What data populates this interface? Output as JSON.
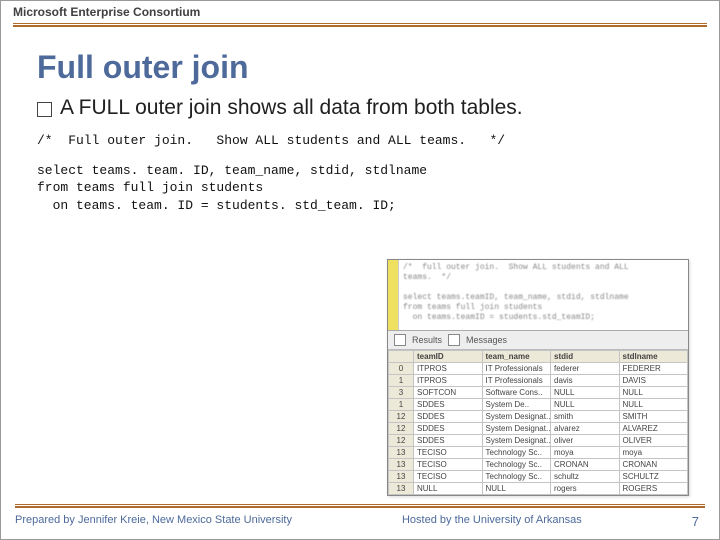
{
  "brand": "Microsoft Enterprise Consortium",
  "title": "Full outer join",
  "bullet": "A FULL outer join shows all data from both tables.",
  "sql_comment": "/*  Full outer join.   Show ALL students and ALL teams.   */",
  "sql_body": "select teams. team. ID, team_name, stdid, stdlname\nfrom teams full join students\n  on teams. team. ID = students. std_team. ID;",
  "editor_blur": "/*  full outer join.  Show ALL students and ALL\nteams.  */\n\nselect teams.teamID, team_name, stdid, stdlname\nfrom teams full join students\n  on teams.teamID = students.std_teamID;",
  "result_tabs": {
    "a": "Results",
    "b": "Messages"
  },
  "grid": {
    "headers": [
      "",
      "teamID",
      "team_name",
      "stdid",
      "stdlname"
    ],
    "rows": [
      [
        "0",
        "ITPROS",
        "IT Professionals",
        "federer",
        "FEDERER"
      ],
      [
        "1",
        "ITPROS",
        "IT Professionals",
        "davis",
        "DAVIS"
      ],
      [
        "3",
        "SOFTCON",
        "Software Cons..",
        "NULL",
        "NULL"
      ],
      [
        "1",
        "SDDES",
        "System De..",
        "NULL",
        "NULL"
      ],
      [
        "12",
        "SDDES",
        "System Designat..",
        "smith",
        "SMITH"
      ],
      [
        "12",
        "SDDES",
        "System Designat..",
        "alvarez",
        "ALVAREZ"
      ],
      [
        "12",
        "SDDES",
        "System Designat..",
        "oliver",
        "OLIVER"
      ],
      [
        "13",
        "TECISO",
        "Technology Sc..",
        "moya",
        "moya"
      ],
      [
        "13",
        "TECISO",
        "Technology Sc..",
        "CRONAN",
        "CRONAN"
      ],
      [
        "13",
        "TECISO",
        "Technology Sc..",
        "schultz",
        "SCHULTZ"
      ],
      [
        "13",
        "NULL",
        "NULL",
        "rogers",
        "ROGERS"
      ]
    ]
  },
  "footer_left": "Prepared by Jennifer Kreie, New Mexico State University",
  "footer_mid": "Hosted by the University of Arkansas",
  "page_num": "7"
}
